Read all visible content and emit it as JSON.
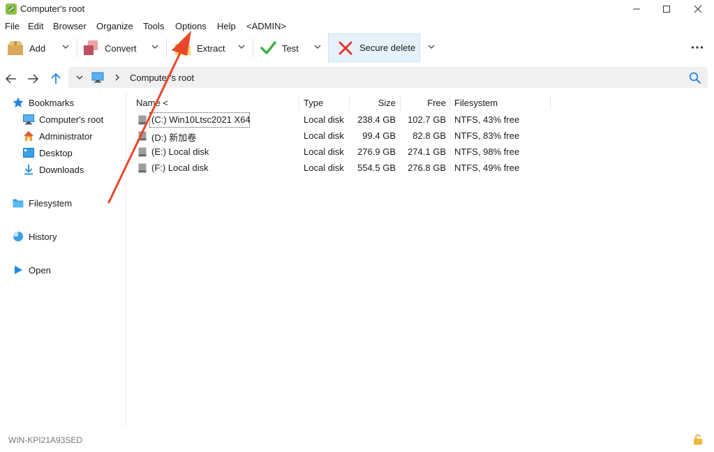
{
  "window": {
    "title": "Computer's root",
    "icon": "peazip-pea-icon",
    "controls": [
      "minimize-icon",
      "maximize-icon",
      "close-icon"
    ]
  },
  "menubar": {
    "items": [
      "File",
      "Edit",
      "Browser",
      "Organize",
      "Tools",
      "Options",
      "Help",
      "<ADMIN>"
    ]
  },
  "toolbar": {
    "add_label": "Add",
    "convert_label": "Convert",
    "extract_label": "Extract",
    "test_label": "Test",
    "secure_delete_label": "Secure delete",
    "more_icon": "more-dots-icon"
  },
  "address": {
    "path": "Computer's root",
    "icons": [
      "back-arrow-icon",
      "forward-arrow-icon",
      "up-arrow-icon",
      "chevron-down-icon",
      "monitor-icon",
      "chevron-right-icon",
      "search-icon"
    ]
  },
  "sidebar": {
    "bookmarks_label": "Bookmarks",
    "bookmarks": [
      "Computer's root",
      "Administrator",
      "Desktop",
      "Downloads"
    ],
    "filesystem_label": "Filesystem",
    "history_label": "History",
    "open_label": "Open"
  },
  "table": {
    "columns": [
      "Name <",
      "Type",
      "Size",
      "Free",
      "Filesystem"
    ],
    "rows": [
      {
        "name": "(C:) Win10Ltsc2021 X64",
        "type": "Local disk",
        "size": "238.4 GB",
        "free": "102.7 GB",
        "fs": "NTFS, 43% free"
      },
      {
        "name": "(D:) 新加卷",
        "type": "Local disk",
        "size": "99.4 GB",
        "free": "82.8 GB",
        "fs": "NTFS, 83% free"
      },
      {
        "name": "(E:) Local disk",
        "type": "Local disk",
        "size": "276.9 GB",
        "free": "274.1 GB",
        "fs": "NTFS, 98% free"
      },
      {
        "name": "(F:) Local disk",
        "type": "Local disk",
        "size": "554.5 GB",
        "free": "276.8 GB",
        "fs": "NTFS, 49% free"
      }
    ]
  },
  "status": {
    "computer_name": "WIN-KPI21A93SED",
    "lock_icon": "unlocked-padlock-icon"
  },
  "colors": {
    "accent_blue": "#1e88e5",
    "annotation_arrow": "#e8472b",
    "secure_delete_bg": "#e7f1fb"
  }
}
